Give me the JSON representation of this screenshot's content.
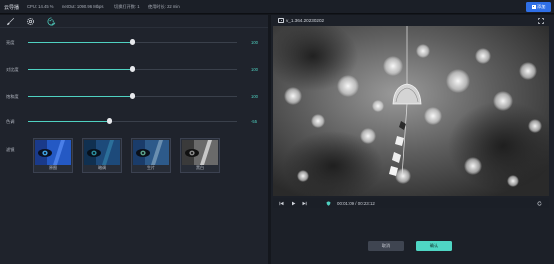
{
  "topbar": {
    "title": "云导播",
    "cpu": "CPU: 14.45 %",
    "netout": "netOut: 1090.96 Mbps",
    "total_streams": "切换打开数: 1",
    "duration": "使用时长: 22 min",
    "add_button": "添加"
  },
  "toolbar": {
    "tools": [
      {
        "icon": "brush-icon"
      },
      {
        "icon": "settings-icon"
      },
      {
        "icon": "palette-icon"
      }
    ]
  },
  "adjustments": [
    {
      "label": "亮度",
      "value": "100",
      "level": 0.5
    },
    {
      "label": "对比度",
      "value": "100",
      "level": 0.5
    },
    {
      "label": "饱和度",
      "value": "100",
      "level": 0.5
    },
    {
      "label": "色调",
      "value": "-55",
      "level": 0.39
    }
  ],
  "filters": {
    "label": "滤镜",
    "items": [
      {
        "name": "原图"
      },
      {
        "name": "暗调"
      },
      {
        "name": "生片"
      },
      {
        "name": "黑白"
      }
    ]
  },
  "player": {
    "filename": "v_1.364.20230202",
    "time_display": "00:01:09 / 00:23:12"
  },
  "actions": {
    "cancel": "取消",
    "confirm": "确认"
  },
  "colors": {
    "accent": "#4fd1c1",
    "primary": "#2f6fe6",
    "panel": "#1f232c",
    "background": "#14171d"
  }
}
